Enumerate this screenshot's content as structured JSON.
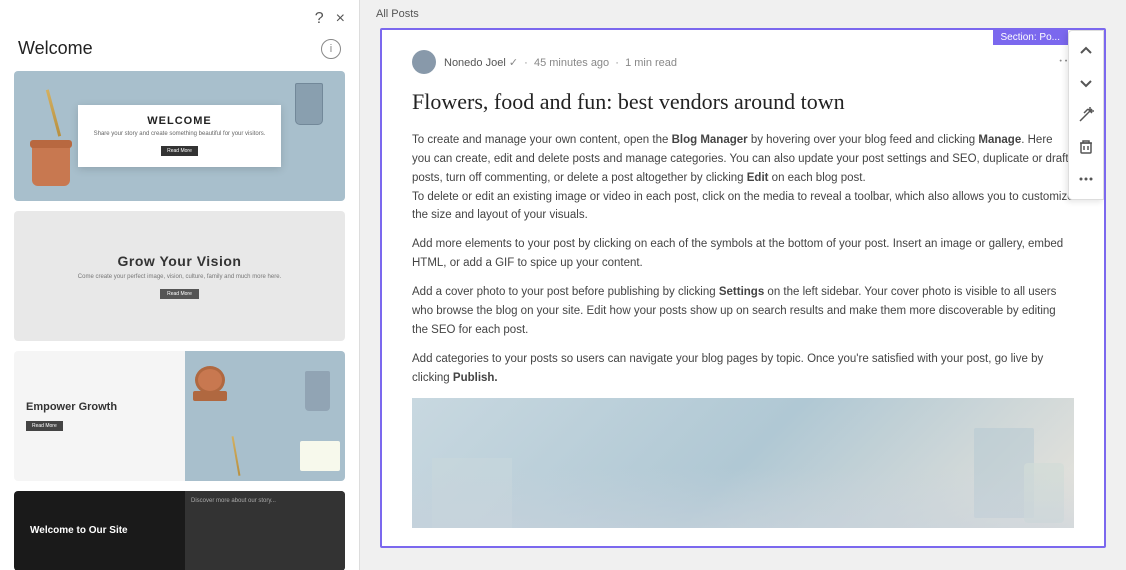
{
  "leftPanel": {
    "helpIcon": "?",
    "closeIcon": "×",
    "title": "Welcome",
    "infoIcon": "i",
    "templates": [
      {
        "id": "welcome",
        "type": "blue-bg",
        "innerTitle": "WELCOME",
        "innerText": "Share your story and create something\nbeautiful for your visitors.",
        "btnLabel": "Read More"
      },
      {
        "id": "grow",
        "type": "grey-bg",
        "title": "Grow Your Vision",
        "text": "Come create your perfect image, vision, culture,\nfamily and much more here.",
        "btnLabel": "Read More"
      },
      {
        "id": "empower",
        "type": "split",
        "leftTitle": "Empower\nGrowth",
        "btnLabel": "Read More"
      },
      {
        "id": "dark",
        "type": "dark",
        "title": "Welcome\nto Our Site",
        "subText": "Discover more about our story..."
      }
    ]
  },
  "breadcrumb": "All Posts",
  "sectionLabel": "Section: Po...",
  "toolbar": {
    "upIcon": "↑",
    "downIcon": "↓",
    "wandIcon": "✦",
    "deleteIcon": "🗑",
    "moreIcon": "⋯"
  },
  "blogPost": {
    "authorName": "Nonedo Joel",
    "authorVerified": "✓",
    "timeAgo": "45 minutes ago",
    "readTime": "1 min read",
    "title": "Flowers, food and fun: best vendors around town",
    "paragraphs": [
      "To create and manage your own content, open the Blog Manager by hovering over your blog feed and clicking Manage. Here you can create, edit and delete posts and manage categories. You can also update your post settings and SEO, duplicate or draft posts, turn off commenting, or delete a post altogether by clicking Edit on each blog post.",
      "To delete or edit an existing image or video in each post, click on the media to reveal a toolbar, which also allows you to customize the size and layout of your visuals.",
      "Add more elements to your post by clicking on each of the symbols at the bottom of your post. Insert an image or gallery, embed HTML, or add a GIF to spice up your content.",
      "Add a cover photo to your post before publishing by clicking Settings on the left sidebar. Your cover photo is visible to all users who browse the blog on your site. Edit how your posts show up on search results and make them more discoverable by editing the SEO for each post.",
      "Add categories to your posts so users can navigate your blog pages by topic. Once you're satisfied with your post, go live by clicking Publish."
    ],
    "boldTerms": [
      "Blog Manager",
      "Manage",
      "Edit",
      "Settings",
      "Publish."
    ]
  }
}
